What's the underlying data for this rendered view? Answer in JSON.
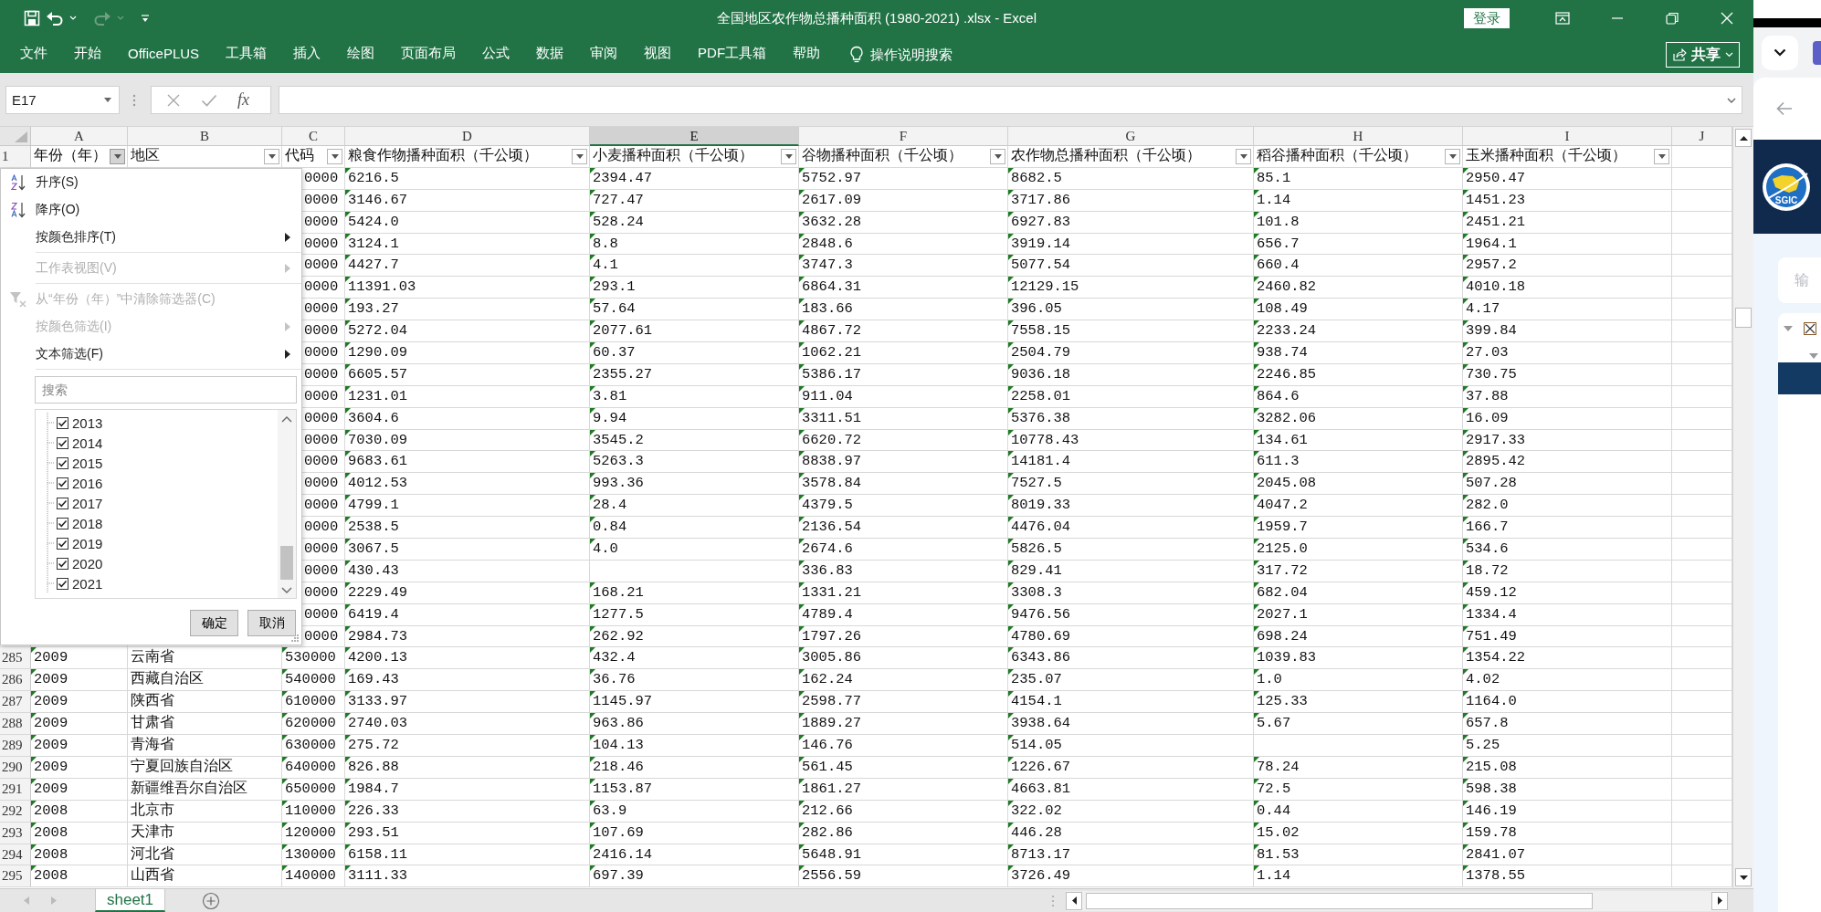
{
  "title_bar": {
    "quick_access": [
      {
        "kind": "save",
        "disabled": false
      },
      {
        "kind": "undo",
        "disabled": false
      },
      {
        "kind": "redo",
        "disabled": true
      },
      {
        "kind": "customize",
        "disabled": false
      }
    ],
    "title": "全国地区农作物总播种面积 (1980-2021) .xlsx - Excel",
    "login_button": "登录"
  },
  "ribbon": {
    "tabs": [
      {
        "label": "文件",
        "selected": false
      },
      {
        "label": "开始",
        "selected": false
      },
      {
        "label": "OfficePLUS",
        "selected": false
      },
      {
        "label": "工具箱",
        "selected": false
      },
      {
        "label": "插入",
        "selected": false
      },
      {
        "label": "绘图",
        "selected": false
      },
      {
        "label": "页面布局",
        "selected": false
      },
      {
        "label": "公式",
        "selected": false
      },
      {
        "label": "数据",
        "selected": false
      },
      {
        "label": "审阅",
        "selected": false
      },
      {
        "label": "视图",
        "selected": false
      },
      {
        "label": "PDF工具箱",
        "selected": false
      },
      {
        "label": "帮助",
        "selected": false
      }
    ],
    "tell_me": "操作说明搜索",
    "share_button": "共享"
  },
  "formula_bar": {
    "name_box": "E17",
    "function_label": "fx"
  },
  "sheet": {
    "header_row_number": "1",
    "columns": [
      {
        "letter": "A",
        "header": "年份（年）",
        "filter_open": true,
        "selected": false
      },
      {
        "letter": "B",
        "header": "地区",
        "filter_open": false,
        "selected": false
      },
      {
        "letter": "C",
        "header": "代码",
        "filter_open": false,
        "selected": false
      },
      {
        "letter": "D",
        "header": "粮食作物播种面积（千公顷）",
        "filter_open": false,
        "selected": false
      },
      {
        "letter": "E",
        "header": "小麦播种面积（千公顷）",
        "filter_open": false,
        "selected": true
      },
      {
        "letter": "F",
        "header": "谷物播种面积（千公顷）",
        "filter_open": false,
        "selected": false
      },
      {
        "letter": "G",
        "header": "农作物总播种面积（千公顷）",
        "filter_open": false,
        "selected": false
      },
      {
        "letter": "H",
        "header": "稻谷播种面积（千公顷）",
        "filter_open": false,
        "selected": false
      },
      {
        "letter": "I",
        "header": "玉米播种面积（千公顷）",
        "filter_open": false,
        "selected": false
      },
      {
        "letter": "J",
        "selected": false
      }
    ],
    "rows": [
      {
        "cells": [
          null,
          null,
          "0000",
          "6216.5",
          "2394.47",
          "5752.97",
          "8682.5",
          "85.1",
          "2950.47"
        ]
      },
      {
        "cells": [
          null,
          null,
          "0000",
          "3146.67",
          "727.47",
          "2617.09",
          "3717.86",
          "1.14",
          "1451.23"
        ]
      },
      {
        "cells": [
          null,
          null,
          "0000",
          "5424.0",
          "528.24",
          "3632.28",
          "6927.83",
          "101.8",
          "2451.21"
        ]
      },
      {
        "cells": [
          null,
          null,
          "0000",
          "3124.1",
          "8.8",
          "2848.6",
          "3919.14",
          "656.7",
          "1964.1"
        ]
      },
      {
        "cells": [
          null,
          null,
          "0000",
          "4427.7",
          "4.1",
          "3747.3",
          "5077.54",
          "660.4",
          "2957.2"
        ]
      },
      {
        "cells": [
          null,
          null,
          "0000",
          "11391.03",
          "293.1",
          "6864.31",
          "12129.15",
          "2460.82",
          "4010.18"
        ]
      },
      {
        "cells": [
          null,
          null,
          "0000",
          "193.27",
          "57.64",
          "183.66",
          "396.05",
          "108.49",
          "4.17"
        ]
      },
      {
        "cells": [
          null,
          null,
          "0000",
          "5272.04",
          "2077.61",
          "4867.72",
          "7558.15",
          "2233.24",
          "399.84"
        ]
      },
      {
        "cells": [
          null,
          null,
          "0000",
          "1290.09",
          "60.37",
          "1062.21",
          "2504.79",
          "938.74",
          "27.03"
        ]
      },
      {
        "cells": [
          null,
          null,
          "0000",
          "6605.57",
          "2355.27",
          "5386.17",
          "9036.18",
          "2246.85",
          "730.75"
        ]
      },
      {
        "cells": [
          null,
          null,
          "0000",
          "1231.01",
          "3.81",
          "911.04",
          "2258.01",
          "864.6",
          "37.88"
        ]
      },
      {
        "cells": [
          null,
          null,
          "0000",
          "3604.6",
          "9.94",
          "3311.51",
          "5376.38",
          "3282.06",
          "16.09"
        ]
      },
      {
        "cells": [
          null,
          null,
          "0000",
          "7030.09",
          "3545.2",
          "6620.72",
          "10778.43",
          "134.61",
          "2917.33"
        ]
      },
      {
        "cells": [
          null,
          null,
          "0000",
          "9683.61",
          "5263.3",
          "8838.97",
          "14181.4",
          "611.3",
          "2895.42"
        ]
      },
      {
        "cells": [
          null,
          null,
          "0000",
          "4012.53",
          "993.36",
          "3578.84",
          "7527.5",
          "2045.08",
          "507.28"
        ]
      },
      {
        "cells": [
          null,
          null,
          "0000",
          "4799.1",
          "28.4",
          "4379.5",
          "8019.33",
          "4047.2",
          "282.0"
        ]
      },
      {
        "cells": [
          null,
          null,
          "0000",
          "2538.5",
          "0.84",
          "2136.54",
          "4476.04",
          "1959.7",
          "166.7"
        ]
      },
      {
        "cells": [
          null,
          null,
          "0000",
          "3067.5",
          "4.0",
          "2674.6",
          "5826.5",
          "2125.0",
          "534.6"
        ]
      },
      {
        "cells": [
          null,
          null,
          "0000",
          "430.43",
          null,
          "336.83",
          "829.41",
          "317.72",
          "18.72"
        ]
      },
      {
        "cells": [
          null,
          null,
          "0000",
          "2229.49",
          "168.21",
          "1331.21",
          "3308.3",
          "682.04",
          "459.12"
        ]
      },
      {
        "cells": [
          null,
          null,
          "0000",
          "6419.4",
          "1277.5",
          "4789.4",
          "9476.56",
          "2027.1",
          "1334.4"
        ]
      },
      {
        "cells": [
          null,
          null,
          "0000",
          "2984.73",
          "262.92",
          "1797.26",
          "4780.69",
          "698.24",
          "751.49"
        ]
      },
      {
        "number": "285",
        "cells": [
          "2009",
          "云南省",
          "530000",
          "4200.13",
          "432.4",
          "3005.86",
          "6343.86",
          "1039.83",
          "1354.22"
        ]
      },
      {
        "number": "286",
        "cells": [
          "2009",
          "西藏自治区",
          "540000",
          "169.43",
          "36.76",
          "162.24",
          "235.07",
          "1.0",
          "4.02"
        ]
      },
      {
        "number": "287",
        "cells": [
          "2009",
          "陕西省",
          "610000",
          "3133.97",
          "1145.97",
          "2598.77",
          "4154.1",
          "125.33",
          "1164.0"
        ]
      },
      {
        "number": "288",
        "cells": [
          "2009",
          "甘肃省",
          "620000",
          "2740.03",
          "963.86",
          "1889.27",
          "3938.64",
          "5.67",
          "657.8"
        ]
      },
      {
        "number": "289",
        "cells": [
          "2009",
          "青海省",
          "630000",
          "275.72",
          "104.13",
          "146.76",
          "514.05",
          null,
          "5.25"
        ]
      },
      {
        "number": "290",
        "cells": [
          "2009",
          "宁夏回族自治区",
          "640000",
          "826.88",
          "218.46",
          "561.45",
          "1226.67",
          "78.24",
          "215.08"
        ]
      },
      {
        "number": "291",
        "cells": [
          "2009",
          "新疆维吾尔自治区",
          "650000",
          "1984.7",
          "1153.87",
          "1861.27",
          "4663.81",
          "72.5",
          "598.38"
        ]
      },
      {
        "number": "292",
        "cells": [
          "2008",
          "北京市",
          "110000",
          "226.33",
          "63.9",
          "212.66",
          "322.02",
          "0.44",
          "146.19"
        ]
      },
      {
        "number": "293",
        "cells": [
          "2008",
          "天津市",
          "120000",
          "293.51",
          "107.69",
          "282.86",
          "446.28",
          "15.02",
          "159.78"
        ]
      },
      {
        "number": "294",
        "cells": [
          "2008",
          "河北省",
          "130000",
          "6158.11",
          "2416.14",
          "5648.91",
          "8713.17",
          "81.53",
          "2841.07"
        ]
      },
      {
        "number": "295",
        "cells": [
          "2008",
          "山西省",
          "140000",
          "3111.33",
          "697.39",
          "2556.59",
          "3726.49",
          "1.14",
          "1378.55"
        ]
      }
    ]
  },
  "filter_menu": {
    "items": [
      {
        "kind": "sort_ascending",
        "label": "升序(S)",
        "disabled": false
      },
      {
        "kind": "sort_descending",
        "label": "降序(O)",
        "disabled": false
      },
      {
        "kind": "submenu",
        "label": "按颜色排序(T)",
        "disabled": false
      },
      {
        "kind": "separator"
      },
      {
        "kind": "submenu",
        "label": "工作表视图(V)",
        "disabled": true
      },
      {
        "kind": "separator"
      },
      {
        "kind": "clear_filter",
        "label": "从“年份（年）”中清除筛选器(C)",
        "disabled": true
      },
      {
        "kind": "submenu",
        "label": "按颜色筛选(I)",
        "disabled": true
      },
      {
        "kind": "submenu",
        "label": "文本筛选(F)",
        "disabled": false
      },
      {
        "kind": "separator"
      }
    ],
    "search": {
      "placeholder": "搜索"
    },
    "values": [
      {
        "label": "2013",
        "checked": true
      },
      {
        "label": "2014",
        "checked": true
      },
      {
        "label": "2015",
        "checked": true
      },
      {
        "label": "2016",
        "checked": true
      },
      {
        "label": "2017",
        "checked": true
      },
      {
        "label": "2018",
        "checked": true
      },
      {
        "label": "2019",
        "checked": true
      },
      {
        "label": "2020",
        "checked": true
      },
      {
        "label": "2021",
        "checked": true
      }
    ],
    "buttons": [
      "确定",
      "取消"
    ]
  },
  "sheet_tabs": [
    {
      "label": "sheet1",
      "selected": true
    }
  ],
  "side_panel": {
    "logo_text": "SGIC",
    "search": {
      "placeholder": "输"
    }
  }
}
